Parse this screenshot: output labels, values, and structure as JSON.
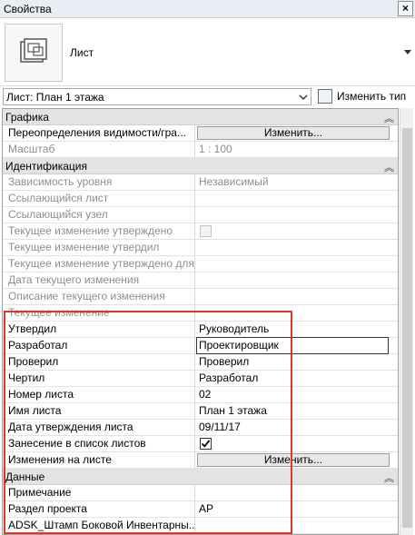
{
  "window": {
    "title": "Свойства"
  },
  "type_selector": {
    "type_name": "Лист",
    "icon": "sheet-icon"
  },
  "instance_selector": {
    "value": "Лист: План 1 этажа",
    "edit_type_label": "Изменить тип"
  },
  "groups": {
    "graphics": {
      "label": "Графика",
      "vis_overrides": {
        "name": "Переопределения видимости/гра...",
        "button": "Изменить..."
      },
      "scale": {
        "name": "Масштаб",
        "value": "1 : 100"
      }
    },
    "identity": {
      "label": "Идентификация",
      "rows": [
        {
          "name": "Зависимость уровня",
          "value": "Независимый"
        },
        {
          "name": "Ссылающийся лист",
          "value": ""
        },
        {
          "name": "Ссылающийся узел",
          "value": ""
        },
        {
          "name": "Текущее изменение утверждено",
          "value": ""
        },
        {
          "name": "Текущее изменение утвердил",
          "value": ""
        },
        {
          "name": "Текущее изменение утверждено для",
          "value": ""
        },
        {
          "name": "Дата текущего изменения",
          "value": ""
        },
        {
          "name": "Описание текущего изменения",
          "value": ""
        },
        {
          "name": "Текущее изменение",
          "value": ""
        },
        {
          "name": "Утвердил",
          "value": "Руководитель"
        },
        {
          "name": "Разработал",
          "value": "Проектировщик"
        },
        {
          "name": "Проверил",
          "value": "Проверил"
        },
        {
          "name": "Чертил",
          "value": "Разработал"
        },
        {
          "name": "Номер листа",
          "value": "02"
        },
        {
          "name": "Имя листа",
          "value": "План 1 этажа"
        },
        {
          "name": "Дата утверждения листа",
          "value": "09/11/17"
        },
        {
          "name": "Занесение в список листов",
          "value": ""
        },
        {
          "name": "Изменения на листе",
          "value": "Изменить..."
        }
      ]
    },
    "data": {
      "label": "Данные",
      "rows": [
        {
          "name": "Примечание",
          "value": ""
        },
        {
          "name": "Раздел проекта",
          "value": "АР"
        },
        {
          "name": "ADSK_Штамп Боковой Инвентарны...",
          "value": ""
        }
      ]
    }
  },
  "colors": {
    "highlight_box": "#e0352b",
    "group_header": "#e3e3e3"
  }
}
